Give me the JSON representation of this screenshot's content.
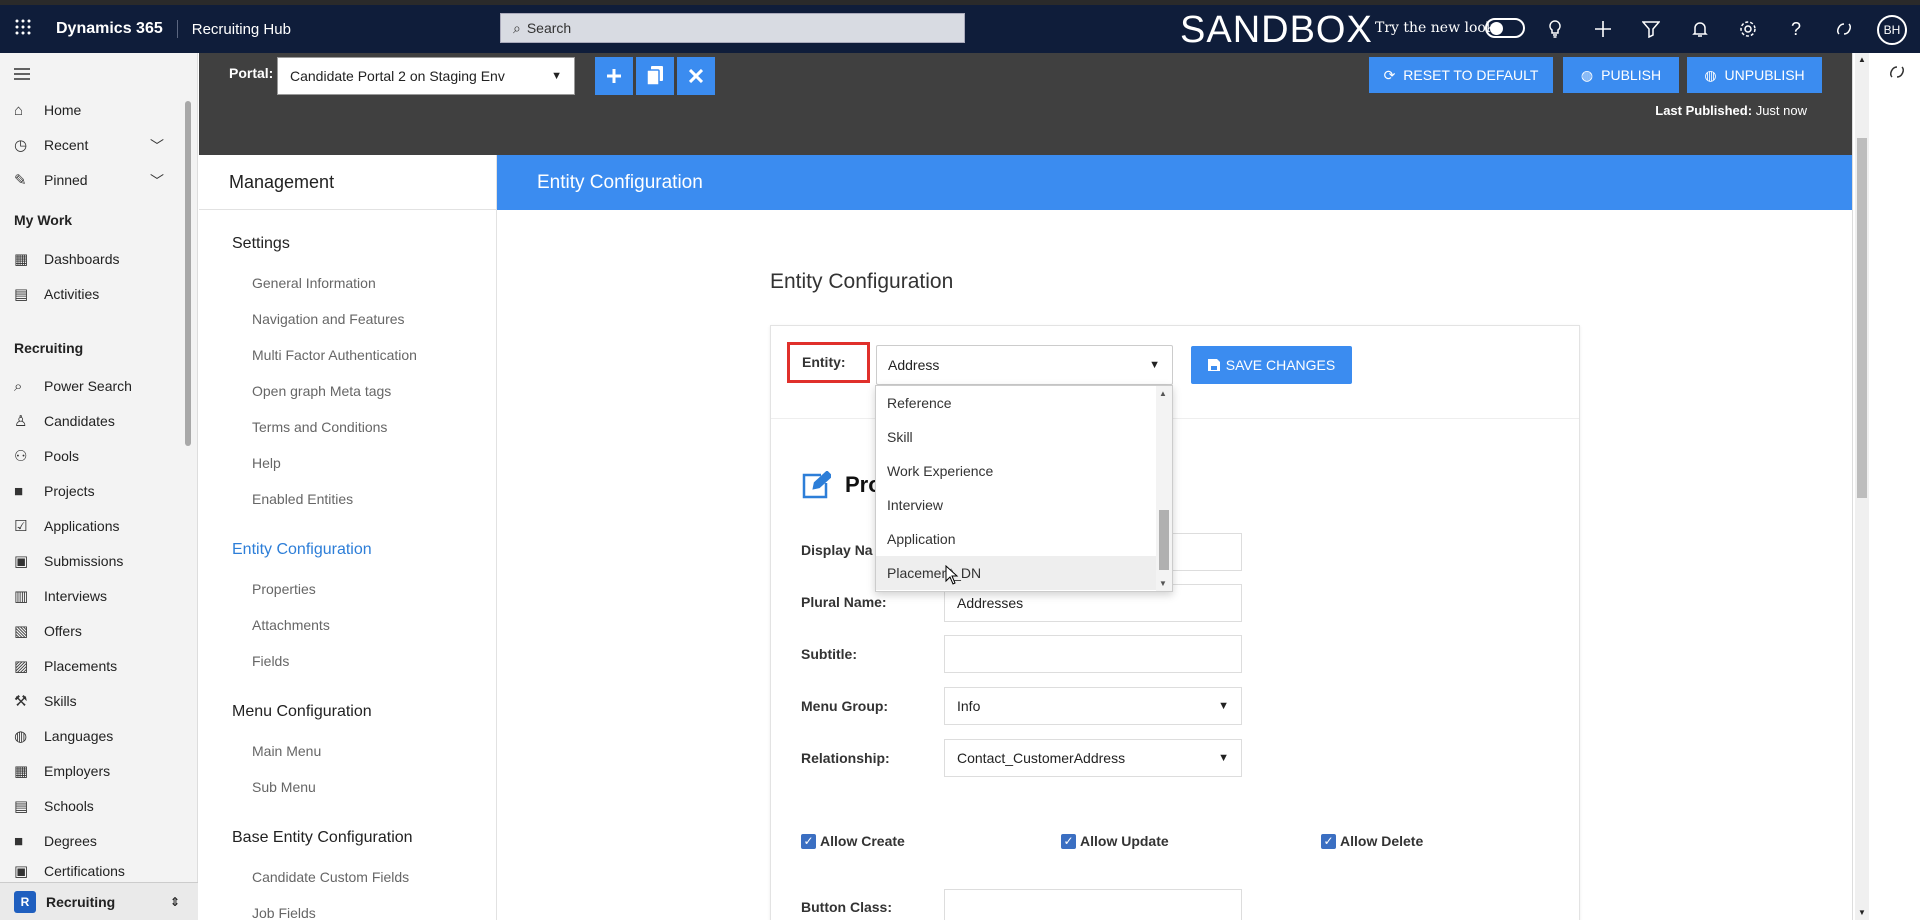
{
  "topbar": {
    "brand": "Dynamics 365",
    "app_name": "Recruiting Hub",
    "search_placeholder": "Search",
    "environment": "SANDBOX",
    "try_new_look": "Try the new look",
    "user_initials": "BH"
  },
  "leftnav": {
    "items_top": [
      {
        "label": "Home",
        "icon": "home-icon"
      },
      {
        "label": "Recent",
        "icon": "clock-icon"
      },
      {
        "label": "Pinned",
        "icon": "pin-icon"
      }
    ],
    "my_work_header": "My Work",
    "my_work": [
      {
        "label": "Dashboards",
        "icon": "dashboard-icon"
      },
      {
        "label": "Activities",
        "icon": "clipboard-icon"
      }
    ],
    "recruiting_header": "Recruiting",
    "recruiting": [
      {
        "label": "Power Search"
      },
      {
        "label": "Candidates"
      },
      {
        "label": "Pools"
      },
      {
        "label": "Projects"
      },
      {
        "label": "Applications"
      },
      {
        "label": "Submissions"
      },
      {
        "label": "Interviews"
      },
      {
        "label": "Offers"
      },
      {
        "label": "Placements"
      },
      {
        "label": "Skills"
      },
      {
        "label": "Languages"
      },
      {
        "label": "Employers"
      },
      {
        "label": "Schools"
      },
      {
        "label": "Degrees"
      },
      {
        "label": "Certifications"
      }
    ],
    "footer_badge": "R",
    "footer_label": "Recruiting"
  },
  "portalbar": {
    "portal_label": "Portal:",
    "portal_value": "Candidate Portal 2 on Staging Env",
    "reset_label": "RESET TO DEFAULT",
    "publish_label": "PUBLISH",
    "unpublish_label": "UNPUBLISH",
    "last_published_label": "Last Published:",
    "last_published_value": "Just now"
  },
  "management": {
    "title": "Management",
    "settings_header": "Settings",
    "settings_items": [
      "General Information",
      "Navigation and Features",
      "Multi Factor Authentication",
      "Open graph Meta tags",
      "Terms and Conditions",
      "Help",
      "Enabled Entities"
    ],
    "entity_config_header": "Entity Configuration",
    "entity_config_items": [
      "Properties",
      "Attachments",
      "Fields"
    ],
    "menu_config_header": "Menu Configuration",
    "menu_config_items": [
      "Main Menu",
      "Sub Menu"
    ],
    "base_entity_header": "Base Entity Configuration",
    "base_entity_items": [
      "Candidate Custom Fields",
      "Job Fields"
    ]
  },
  "content": {
    "header": "Entity Configuration",
    "title": "Entity Configuration",
    "entity_label": "Entity:",
    "entity_value": "Address",
    "save_label": "SAVE CHANGES",
    "properties_title": "Pro",
    "display_name_label": "Display Na",
    "plural_name_label": "Plural Name:",
    "plural_name_value": "Addresses",
    "subtitle_label": "Subtitle:",
    "subtitle_value": "",
    "menu_group_label": "Menu Group:",
    "menu_group_value": "Info",
    "relationship_label": "Relationship:",
    "relationship_value": "Contact_CustomerAddress",
    "allow_create": "Allow Create",
    "allow_update": "Allow Update",
    "allow_delete": "Allow Delete",
    "button_class_label": "Button Class:"
  },
  "dropdown": {
    "options": [
      "Reference",
      "Skill",
      "Work Experience",
      "Interview",
      "Application",
      "Placement_DN"
    ],
    "hovered_index": 5
  }
}
